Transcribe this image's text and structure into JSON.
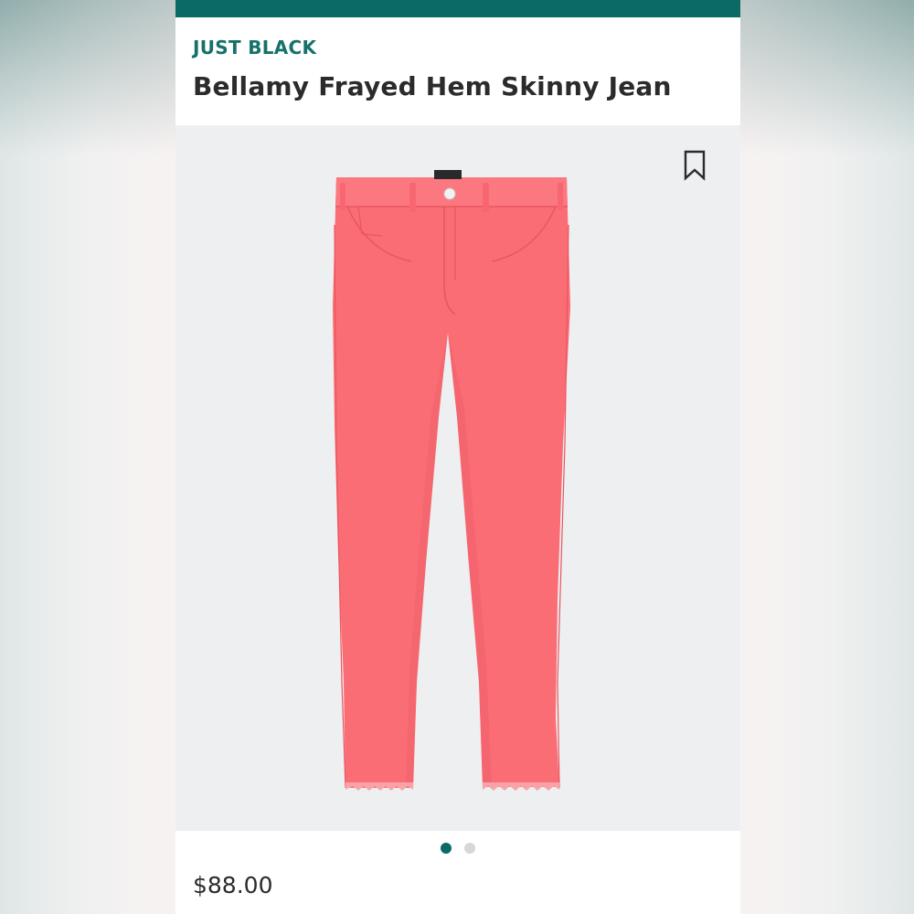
{
  "product": {
    "brand": "JUST BLACK",
    "title": "Bellamy Frayed Hem Skinny Jean",
    "price": "$88.00",
    "image_icon": "pink-skinny-jeans-image",
    "bookmark_icon": "bookmark-icon"
  },
  "carousel": {
    "total_slides": 2,
    "active_index": 0
  },
  "colors": {
    "accent": "#0b6b64",
    "brand_text": "#16716b",
    "jean_color": "#fb6d75",
    "dot_active": "#0b6b64",
    "dot_inactive": "#d5d7d9"
  }
}
